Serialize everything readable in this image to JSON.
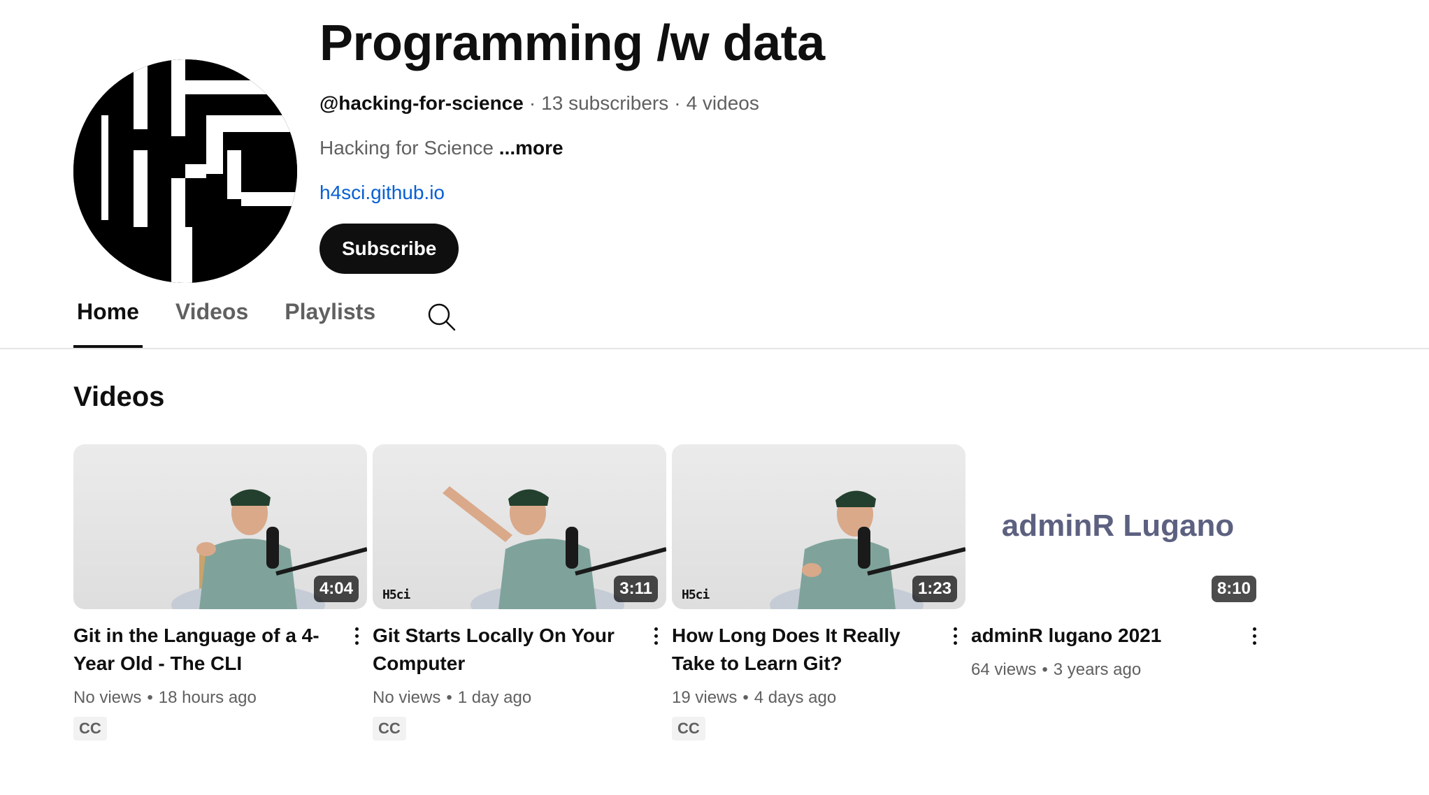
{
  "channel": {
    "title": "Programming /w data",
    "handle": "@hacking-for-science",
    "subscribers": "13 subscribers",
    "videos_count": "4 videos",
    "separator": "·",
    "description": "Hacking for Science",
    "more_label": "...more",
    "link": "h4sci.github.io",
    "subscribe_label": "Subscribe",
    "avatar_icon": "h4s-logo-icon"
  },
  "tabs": [
    {
      "label": "Home",
      "active": true
    },
    {
      "label": "Videos",
      "active": false
    },
    {
      "label": "Playlists",
      "active": false
    }
  ],
  "search_icon": "search-icon",
  "section": {
    "title": "Videos"
  },
  "videos": [
    {
      "title": "Git in the Language of a 4-Year Old - The CLI",
      "views": "No views",
      "age": "18 hours ago",
      "duration": "4:04",
      "badge": "CC",
      "watermark": ""
    },
    {
      "title": "Git Starts Locally On Your Computer",
      "views": "No views",
      "age": "1 day ago",
      "duration": "3:11",
      "badge": "CC",
      "watermark": "H5ci"
    },
    {
      "title": "How Long Does It Really Take to Learn Git?",
      "views": "19 views",
      "age": "4 days ago",
      "duration": "1:23",
      "badge": "CC",
      "watermark": "H5ci"
    },
    {
      "title": "adminR lugano 2021",
      "views": "64 views",
      "age": "3 years ago",
      "duration": "8:10",
      "badge": "",
      "thumb_text": "adminR Lugano"
    }
  ],
  "stats_separator": "•",
  "colors": {
    "text_primary": "#0f0f0f",
    "text_secondary": "#606060",
    "link": "#065fd4",
    "subscribe_bg": "#0f0f0f",
    "thumb_text": "#5d6180"
  }
}
